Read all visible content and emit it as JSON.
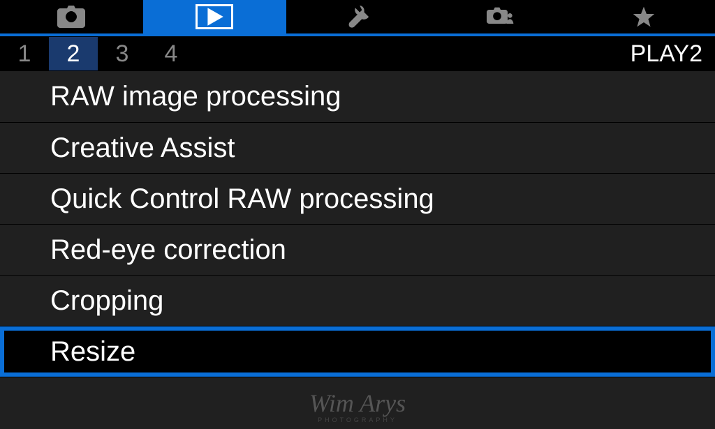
{
  "topTabs": {
    "activeIndex": 1
  },
  "pageTabs": {
    "items": [
      "1",
      "2",
      "3",
      "4"
    ],
    "activeIndex": 1,
    "label": "PLAY2"
  },
  "menu": {
    "items": [
      "RAW image processing",
      "Creative Assist",
      "Quick Control RAW processing",
      "Red-eye correction",
      "Cropping",
      "Resize"
    ],
    "selectedIndex": 5
  },
  "watermark": {
    "name": "Wim Arys",
    "sub": "PHOTOGRAPHY"
  }
}
